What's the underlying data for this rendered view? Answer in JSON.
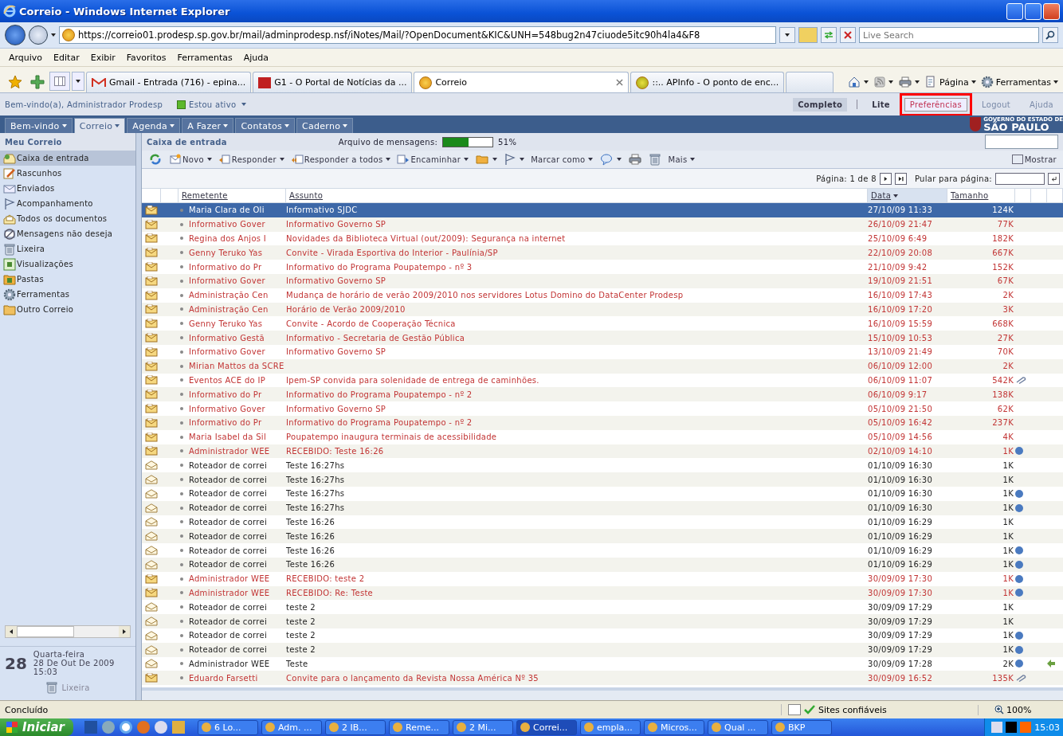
{
  "window": {
    "title": "Correio - Windows Internet Explorer"
  },
  "address_bar": {
    "url": "https://correio01.prodesp.sp.gov.br/mail/adminprodesp.nsf/iNotes/Mail/?OpenDocument&KIC&UNH=548bug2n47ciuode5itc90h4la4&F8",
    "search_placeholder": "Live Search"
  },
  "menu_bar": [
    "Arquivo",
    "Editar",
    "Exibir",
    "Favoritos",
    "Ferramentas",
    "Ajuda"
  ],
  "browser_tabs": [
    {
      "kind": "gmail",
      "label": "Gmail - Entrada (716) - epina...",
      "selected": false
    },
    {
      "kind": "g1",
      "label": "G1 - O Portal de Notícias da ...",
      "selected": false
    },
    {
      "kind": "site",
      "label": "Correio",
      "selected": true
    },
    {
      "kind": "apinfo",
      "label": "::.. APInfo - O ponto de enc...",
      "selected": false
    },
    {
      "kind": "new"
    }
  ],
  "command_bar": [
    {
      "kind": "home"
    },
    {
      "kind": "feed"
    },
    {
      "kind": "print"
    },
    {
      "kind": "page",
      "label": "Página"
    },
    {
      "kind": "tools",
      "label": "Ferramentas"
    }
  ],
  "notes_header": {
    "welcome": "Bem-vindo(a), Administrador Prodesp",
    "status": "Estou ativo",
    "views": [
      {
        "label": "Completo",
        "selected": true
      },
      {
        "label": "Lite",
        "selected": false
      }
    ],
    "links": [
      {
        "label": "Preferências",
        "highlighted": true
      },
      {
        "label": "Logout",
        "highlighted": false
      },
      {
        "label": "Ajuda",
        "highlighted": false
      }
    ],
    "logo": {
      "line1": "GOVERNO DO ESTADO DE",
      "line2": "SÃO PAULO"
    }
  },
  "nav_tabs": [
    {
      "label": "Bem-vindo",
      "selected": false
    },
    {
      "label": "Correio",
      "selected": true
    },
    {
      "label": "Agenda",
      "selected": false
    },
    {
      "label": "A Fazer",
      "selected": false
    },
    {
      "label": "Contatos",
      "selected": false
    },
    {
      "label": "Caderno",
      "selected": false
    }
  ],
  "sidebar": {
    "title": "Meu Correio",
    "items": [
      {
        "kind": "inbox",
        "label": "Caixa de entrada",
        "selected": true
      },
      {
        "kind": "drafts",
        "label": "Rascunhos",
        "selected": false
      },
      {
        "kind": "sent",
        "label": "Enviados",
        "selected": false
      },
      {
        "kind": "flag",
        "label": "Acompanhamento",
        "selected": false
      },
      {
        "kind": "all",
        "label": "Todos os documentos",
        "selected": false
      },
      {
        "kind": "junk",
        "label": "Mensagens não deseja",
        "selected": false
      },
      {
        "kind": "trash",
        "label": "Lixeira",
        "selected": false
      },
      {
        "kind": "views",
        "label": "Visualizações",
        "selected": false
      },
      {
        "kind": "folders",
        "label": "Pastas",
        "selected": false
      },
      {
        "kind": "tools",
        "label": "Ferramentas",
        "selected": false
      },
      {
        "kind": "other",
        "label": "Outro Correio",
        "selected": false
      }
    ],
    "calendar": {
      "day": "28",
      "weekday": "Quarta-feira",
      "date": "28 De Out De 2009",
      "time": "15:03"
    },
    "trash": "Lixeira"
  },
  "mail": {
    "folder": "Caixa de entrada",
    "quota_label": "Arquivo de mensagens:",
    "quota": {
      "level": 0.51
    },
    "quota_reading": "51%",
    "toolbar": [
      {
        "kind": "refresh",
        "menu": false
      },
      {
        "kind": "new",
        "label": "Novo",
        "menu": true
      },
      {
        "kind": "reply",
        "label": "Responder",
        "menu": true
      },
      {
        "kind": "reply-all",
        "label": "Responder a todos",
        "menu": true
      },
      {
        "kind": "forward",
        "label": "Encaminhar",
        "menu": true
      },
      {
        "kind": "folder",
        "menu": true
      },
      {
        "kind": "flag",
        "menu": true
      },
      {
        "kind": "text",
        "label": "Marcar como",
        "menu": true
      },
      {
        "kind": "chat",
        "menu": true
      },
      {
        "kind": "print",
        "menu": false
      },
      {
        "kind": "trash",
        "menu": false
      },
      {
        "kind": "text",
        "label": "Mais",
        "menu": true
      }
    ],
    "show_button": "Mostrar",
    "pagination": {
      "label": "Página: 1 de 8",
      "jump_label": "Pular para página:"
    },
    "columns": [
      {
        "label": "Remetente",
        "sorted": false
      },
      {
        "label": "Assunto",
        "sorted": false
      },
      {
        "label": "Data",
        "sorted": true
      },
      {
        "label": "Tamanho",
        "sorted": false
      }
    ],
    "rows": [
      {
        "sender": "Maria Clara de Oli",
        "subject": "Informativo SJDC",
        "date": "27/10/09 11:33",
        "size": "124K",
        "unread": true,
        "selected": true,
        "dot": false,
        "attachment": false,
        "replied": false
      },
      {
        "sender": "Informativo Gover",
        "subject": "Informativo Governo SP",
        "date": "26/10/09 21:47",
        "size": "77K",
        "unread": true,
        "selected": false,
        "dot": false,
        "attachment": false,
        "replied": false
      },
      {
        "sender": "Regina dos Anjos I",
        "subject": "Novidades da Biblioteca Virtual (out/2009): Segurança na internet",
        "date": "25/10/09 6:49",
        "size": "182K",
        "unread": true,
        "selected": false,
        "dot": false,
        "attachment": false,
        "replied": false
      },
      {
        "sender": "Genny Teruko Yas",
        "subject": "Convite - Virada Esportiva do Interior - Paulínia/SP",
        "date": "22/10/09 20:08",
        "size": "667K",
        "unread": true,
        "selected": false,
        "dot": false,
        "attachment": false,
        "replied": false
      },
      {
        "sender": "Informativo do Pr",
        "subject": "Informativo do Programa Poupatempo - nº 3",
        "date": "21/10/09 9:42",
        "size": "152K",
        "unread": true,
        "selected": false,
        "dot": false,
        "attachment": false,
        "replied": false
      },
      {
        "sender": "Informativo Gover",
        "subject": "Informativo Governo SP",
        "date": "19/10/09 21:51",
        "size": "67K",
        "unread": true,
        "selected": false,
        "dot": false,
        "attachment": false,
        "replied": false
      },
      {
        "sender": "Administração Cen",
        "subject": "Mudança de horário de verão 2009/2010 nos servidores Lotus Domino do DataCenter Prodesp",
        "date": "16/10/09 17:43",
        "size": "2K",
        "unread": true,
        "selected": false,
        "dot": false,
        "attachment": false,
        "replied": false
      },
      {
        "sender": "Administração Cen",
        "subject": "Horário de Verão 2009/2010",
        "date": "16/10/09 17:20",
        "size": "3K",
        "unread": true,
        "selected": false,
        "dot": false,
        "attachment": false,
        "replied": false
      },
      {
        "sender": "Genny Teruko Yas",
        "subject": "Convite - Acordo de Cooperação Técnica",
        "date": "16/10/09 15:59",
        "size": "668K",
        "unread": true,
        "selected": false,
        "dot": false,
        "attachment": false,
        "replied": false
      },
      {
        "sender": "Informativo Gestã",
        "subject": "Informativo - Secretaria de Gestão Pública",
        "date": "15/10/09 10:53",
        "size": "27K",
        "unread": true,
        "selected": false,
        "dot": false,
        "attachment": false,
        "replied": false
      },
      {
        "sender": "Informativo Gover",
        "subject": "Informativo Governo SP",
        "date": "13/10/09 21:49",
        "size": "70K",
        "unread": true,
        "selected": false,
        "dot": false,
        "attachment": false,
        "replied": false
      },
      {
        "sender": "Mirian Mattos da SCRE",
        "date": "06/10/09 12:00",
        "size": "2K",
        "unread": true,
        "selected": false,
        "dot": false,
        "attachment": false,
        "replied": false
      },
      {
        "sender": "Eventos ACE do IP",
        "subject": "Ipem-SP convida para solenidade de entrega de caminhões.",
        "date": "06/10/09 11:07",
        "size": "542K",
        "unread": true,
        "selected": false,
        "dot": false,
        "attachment": true,
        "replied": false
      },
      {
        "sender": "Informativo do Pr",
        "subject": "Informativo do Programa Poupatempo - nº 2",
        "date": "06/10/09 9:17",
        "size": "138K",
        "unread": true,
        "selected": false,
        "dot": false,
        "attachment": false,
        "replied": false
      },
      {
        "sender": "Informativo Gover",
        "subject": "Informativo Governo SP",
        "date": "05/10/09 21:50",
        "size": "62K",
        "unread": true,
        "selected": false,
        "dot": false,
        "attachment": false,
        "replied": false
      },
      {
        "sender": "Informativo do Pr",
        "subject": "Informativo do Programa Poupatempo - nº 2",
        "date": "05/10/09 16:42",
        "size": "237K",
        "unread": true,
        "selected": false,
        "dot": false,
        "attachment": false,
        "replied": false
      },
      {
        "sender": "Maria Isabel da Sil",
        "subject": "Poupatempo inaugura terminais de acessibilidade",
        "date": "05/10/09 14:56",
        "size": "4K",
        "unread": true,
        "selected": false,
        "dot": false,
        "attachment": false,
        "replied": false
      },
      {
        "sender": "Administrador WEE",
        "subject": "RECEBIDO: Teste 16:26",
        "date": "02/10/09 14:10",
        "size": "1K",
        "unread": true,
        "selected": false,
        "dot": true,
        "attachment": false,
        "replied": false
      },
      {
        "sender": "Roteador de correi",
        "subject": "Teste 16:27hs",
        "date": "01/10/09 16:30",
        "size": "1K",
        "unread": false,
        "selected": false,
        "dot": false,
        "attachment": false,
        "replied": false
      },
      {
        "sender": "Roteador de correi",
        "subject": "Teste 16:27hs",
        "date": "01/10/09 16:30",
        "size": "1K",
        "unread": false,
        "selected": false,
        "dot": false,
        "attachment": false,
        "replied": false
      },
      {
        "sender": "Roteador de correi",
        "subject": "Teste 16:27hs",
        "date": "01/10/09 16:30",
        "size": "1K",
        "unread": false,
        "selected": false,
        "dot": true,
        "attachment": false,
        "replied": false
      },
      {
        "sender": "Roteador de correi",
        "subject": "Teste 16:27hs",
        "date": "01/10/09 16:30",
        "size": "1K",
        "unread": false,
        "selected": false,
        "dot": true,
        "attachment": false,
        "replied": false
      },
      {
        "sender": "Roteador de correi",
        "subject": "Teste 16:26",
        "date": "01/10/09 16:29",
        "size": "1K",
        "unread": false,
        "selected": false,
        "dot": false,
        "attachment": false,
        "replied": false
      },
      {
        "sender": "Roteador de correi",
        "subject": "Teste 16:26",
        "date": "01/10/09 16:29",
        "size": "1K",
        "unread": false,
        "selected": false,
        "dot": false,
        "attachment": false,
        "replied": false
      },
      {
        "sender": "Roteador de correi",
        "subject": "Teste 16:26",
        "date": "01/10/09 16:29",
        "size": "1K",
        "unread": false,
        "selected": false,
        "dot": true,
        "attachment": false,
        "replied": false
      },
      {
        "sender": "Roteador de correi",
        "subject": "Teste 16:26",
        "date": "01/10/09 16:29",
        "size": "1K",
        "unread": false,
        "selected": false,
        "dot": true,
        "attachment": false,
        "replied": false
      },
      {
        "sender": "Administrador WEE",
        "subject": "RECEBIDO: teste 2",
        "date": "30/09/09 17:30",
        "size": "1K",
        "unread": true,
        "selected": false,
        "dot": true,
        "attachment": false,
        "replied": false
      },
      {
        "sender": "Administrador WEE",
        "subject": "RECEBIDO: Re: Teste",
        "date": "30/09/09 17:30",
        "size": "1K",
        "unread": true,
        "selected": false,
        "dot": true,
        "attachment": false,
        "replied": false
      },
      {
        "sender": "Roteador de correi",
        "subject": "teste 2",
        "date": "30/09/09 17:29",
        "size": "1K",
        "unread": false,
        "selected": false,
        "dot": false,
        "attachment": false,
        "replied": false
      },
      {
        "sender": "Roteador de correi",
        "subject": "teste 2",
        "date": "30/09/09 17:29",
        "size": "1K",
        "unread": false,
        "selected": false,
        "dot": false,
        "attachment": false,
        "replied": false
      },
      {
        "sender": "Roteador de correi",
        "subject": "teste 2",
        "date": "30/09/09 17:29",
        "size": "1K",
        "unread": false,
        "selected": false,
        "dot": true,
        "attachment": false,
        "replied": false
      },
      {
        "sender": "Roteador de correi",
        "subject": "teste 2",
        "date": "30/09/09 17:29",
        "size": "1K",
        "unread": false,
        "selected": false,
        "dot": true,
        "attachment": false,
        "replied": false
      },
      {
        "sender": "Administrador WEE",
        "subject": "Teste",
        "date": "30/09/09 17:28",
        "size": "2K",
        "unread": false,
        "selected": false,
        "dot": true,
        "attachment": false,
        "replied": true
      },
      {
        "sender": "Eduardo Farsetti",
        "subject": "Convite para o lançamento da Revista Nossa América Nº 35",
        "date": "30/09/09 16:52",
        "size": "135K",
        "unread": true,
        "selected": false,
        "dot": false,
        "attachment": true,
        "replied": false
      }
    ]
  },
  "status_bar": {
    "text": "Concluído",
    "zone": "Sites confiáveis",
    "zoom": "100%"
  },
  "taskbar": {
    "start": "Iniciar",
    "quick_launch": [
      {
        "kind": "desktop"
      },
      {
        "kind": "ie-e"
      },
      {
        "kind": "ie"
      },
      {
        "kind": "firefox"
      },
      {
        "kind": "media"
      },
      {
        "kind": "folder"
      }
    ],
    "tasks": [
      {
        "label": "6 Lo...",
        "selected": false
      },
      {
        "label": "Adm. ...",
        "selected": false
      },
      {
        "label": "2 IB...",
        "selected": false
      },
      {
        "label": "Reme...",
        "selected": false
      },
      {
        "label": "2 Mi...",
        "selected": false
      },
      {
        "label": "Correi...",
        "selected": true
      },
      {
        "label": "empla...",
        "selected": false
      },
      {
        "label": "Micros...",
        "selected": false
      },
      {
        "label": "Qual ...",
        "selected": false
      },
      {
        "label": "BKP",
        "selected": false
      }
    ],
    "clock": "15:03"
  }
}
